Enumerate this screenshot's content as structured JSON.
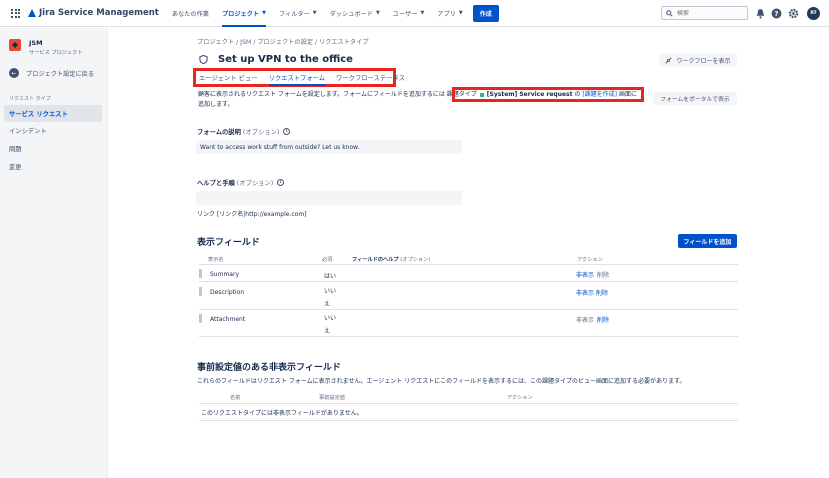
{
  "app": {
    "name": "Jira Service Management"
  },
  "topnav": {
    "items": [
      {
        "label": "あなたの作業"
      },
      {
        "label": "プロジェクト"
      },
      {
        "label": "フィルター"
      },
      {
        "label": "ダッシュボード"
      },
      {
        "label": "ユーザー"
      },
      {
        "label": "アプリ"
      }
    ],
    "create_label": "作成",
    "search_placeholder": "検索",
    "avatar_initials": "RT"
  },
  "sidebar": {
    "project_name": "JSM",
    "project_type": "サービス プロジェクト",
    "back_label": "プロジェクト設定に戻る",
    "section_label": "リクエスト タイプ",
    "items": [
      {
        "label": "サービス リクエスト"
      },
      {
        "label": "インシデント"
      },
      {
        "label": "問題"
      },
      {
        "label": "変更"
      }
    ]
  },
  "breadcrumb": "プロジェクト  /  JSM  /  プロジェクトの設定  /  リクエストタイプ",
  "page_title": "Set up VPN to the office",
  "workflow_button": "ワークフローを表示",
  "tabs": [
    {
      "label": "エージェント ビュー"
    },
    {
      "label": "リクエストフォーム"
    },
    {
      "label": "ワークフローステータス"
    }
  ],
  "description": {
    "line1": "顧客に表示されるリクエスト フォームを設定します。フォームにフィールドを追加するには",
    "issue_type_prefix": "課題タイプ",
    "issue_type": "[System] Service request",
    "connector": "の",
    "create_screen_link": "[課題を作成]",
    "suffix": "画面に",
    "line2": "追加します。"
  },
  "portal_button": "フォームをポータルで表示",
  "form_description": {
    "label": "フォームの説明",
    "optional": "(オプション)",
    "value": "Want to access work stuff from outside? Let us know."
  },
  "help": {
    "label": "ヘルプと手順",
    "optional": "(オプション)",
    "value": "",
    "link_hint": "リンク [リンク名|http://example.com]"
  },
  "visible_fields": {
    "heading": "表示フィールド",
    "add_button": "フィールドを追加",
    "headers": {
      "display_name": "表示名",
      "required": "必須",
      "help": "フィールドのヘルプ",
      "help_optional": "(オプション)",
      "actions": "アクション"
    },
    "rows": [
      {
        "name": "Summary",
        "required": "はい",
        "hide": "非表示",
        "delete": "削除",
        "hide_enabled": true
      },
      {
        "name": "Description",
        "required": "いいえ",
        "hide": "非表示",
        "delete": "削除",
        "hide_enabled": true
      },
      {
        "name": "Attachment",
        "required": "いいえ",
        "hide": "非表示",
        "delete": "削除",
        "hide_enabled": false
      }
    ]
  },
  "hidden_fields": {
    "heading": "事前設定値のある非表示フィールド",
    "subtitle": "これらのフィールドはリクエスト フォームに表示されません。エージェント リクエストにこのフィールドを表示するには、この課題タイプのビュー画面に追加する必要があります。",
    "headers": {
      "name": "名前",
      "preset": "事前設定値",
      "actions": "アクション"
    },
    "empty": "このリクエストタイプには非表示フィールドがありません。"
  }
}
